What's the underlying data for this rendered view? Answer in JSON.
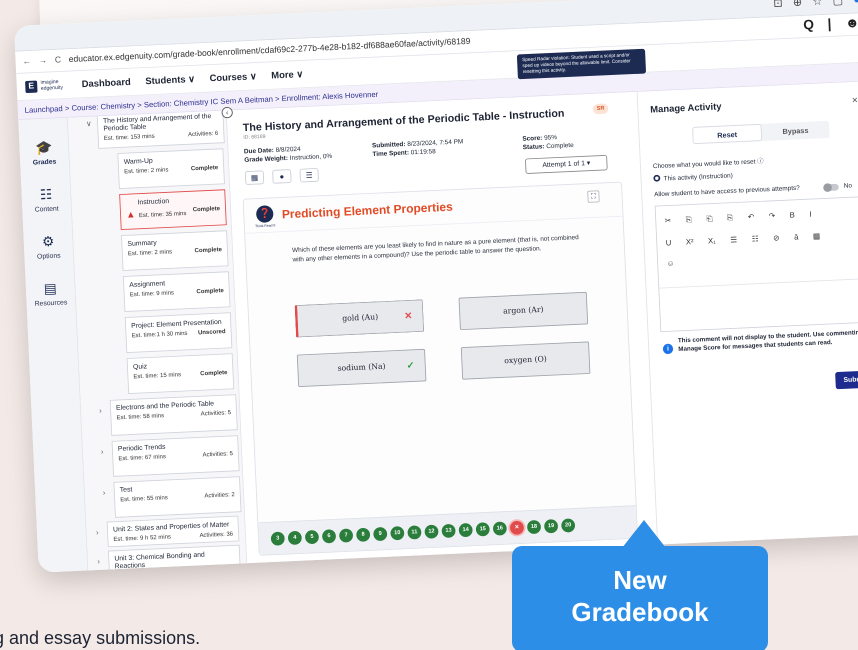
{
  "browser": {
    "url": "educator.ex.edgenuity.com/grade-book/enrollment/cdaf69c2-277b-4e28-b182-df688ae60fae/activity/68189",
    "nav_back": "←",
    "nav_forward": "→",
    "nav_reload": "C"
  },
  "logo": {
    "mark": "E",
    "line1": "imagine",
    "line2": "edgenuity"
  },
  "nav": {
    "dashboard": "Dashboard",
    "students": "Students ∨",
    "courses": "Courses ∨",
    "more": "More ∨"
  },
  "tooltip": "Speed Radar violation: Student used a script and/or sped up videos beyond the allowable limit. Consider resetting this activity.",
  "breadcrumb": "Launchpad > Course: Chemistry > Section: Chemistry IC Sem A Beitman > Enrollment: Alexis Hovenner",
  "leftnav": [
    {
      "label": "Grades",
      "icon": "🎓"
    },
    {
      "label": "Content",
      "icon": "☷"
    },
    {
      "label": "Options",
      "icon": "⚙"
    },
    {
      "label": "Resources",
      "icon": "▤"
    }
  ],
  "tree": {
    "topic": {
      "title": "The History and Arrangement of the Periodic Table",
      "time": "Est. time: 153 mins",
      "activities": "Activities: 6"
    },
    "activities": [
      {
        "title": "Warm-Up",
        "time": "Est. time: 2 mins",
        "status": "Complete"
      },
      {
        "title": "Instruction",
        "time": "Est. time: 35 mins",
        "status": "Complete"
      },
      {
        "title": "Summary",
        "time": "Est. time: 2 mins",
        "status": "Complete"
      },
      {
        "title": "Assignment",
        "time": "Est. time: 9 mins",
        "status": "Complete"
      },
      {
        "title": "Project: Element Presentation",
        "time": "Est. time:1 h 30 mins",
        "status": "Unscored"
      },
      {
        "title": "Quiz",
        "time": "Est. time: 15 mins",
        "status": "Complete"
      }
    ],
    "topics": [
      {
        "title": "Electrons and the Periodic Table",
        "time": "Est. time: 58 mins",
        "activities": "Activities: 5"
      },
      {
        "title": "Periodic Trends",
        "time": "Est. time: 67 mins",
        "activities": "Activities: 5"
      },
      {
        "title": "Test",
        "time": "Est. time: 55 mins",
        "activities": "Activities: 2"
      }
    ],
    "units": [
      {
        "title": "Unit 2: States and Properties of Matter",
        "time": "Est. time: 9 h 52 mins",
        "activities": "Activities: 36"
      },
      {
        "title": "Unit 3: Chemical Bonding and Reactions",
        "time": "",
        "activities": ""
      }
    ]
  },
  "content": {
    "title": "The History and Arrangement of the Periodic Table - Instruction",
    "id": "ID: 68189",
    "badge": "SR",
    "due_label": "Due Date:",
    "due": "8/8/2024",
    "weight_label": "Grade Weight:",
    "weight": "Instruction, 0%",
    "submitted_label": "Submitted:",
    "submitted": "8/23/2024, 7:54 PM",
    "spent_label": "Time Spent:",
    "spent": "01:19:58",
    "score_label": "Score:",
    "score": "95%",
    "status_label": "Status:",
    "status": "Complete",
    "attempt": "Attempt 1 of 1 ▾"
  },
  "question": {
    "brand": "Think Read It",
    "title": "Predicting Element Properties",
    "text": "Which of these elements are you least likely to find in nature as a pure element (that is, not combined with any other elements in a compound)? Use the periodic table to answer the question.",
    "options": [
      {
        "label": "gold (Au)",
        "mark": "✕"
      },
      {
        "label": "argon (Ar)",
        "mark": ""
      },
      {
        "label": "sodium (Na)",
        "mark": "✓"
      },
      {
        "label": "oxygen (O)",
        "mark": ""
      }
    ],
    "dots": [
      "3",
      "4",
      "5",
      "6",
      "7",
      "8",
      "9",
      "10",
      "11",
      "12",
      "13",
      "14",
      "15",
      "16",
      "✕",
      "18",
      "19",
      "20"
    ]
  },
  "manage": {
    "title": "Manage Activity",
    "close": "×",
    "tab_reset": "Reset",
    "tab_bypass": "Bypass",
    "choose_label": "Choose what you would like to reset",
    "choose_option": "This activity (Instruction)",
    "allow_label": "Allow student to have access to previous attempts?",
    "allow_value": "No",
    "toolbar_row1": [
      "✂",
      "⎘",
      "⎗",
      "⎘",
      "↶",
      "↷",
      "B",
      "I"
    ],
    "toolbar_row2": [
      "U",
      "X²",
      "X₁",
      "☰",
      "☷",
      "⊘",
      "ā",
      "▦"
    ],
    "toolbar_row3": [
      "☺"
    ],
    "note": "This comment will not display to the student. Use commenting in Manage Score for messages that students can read.",
    "submit": "Submit"
  },
  "callout": {
    "line1": "New",
    "line2": "Gradebook"
  },
  "footer_text": "g and essay submissions."
}
